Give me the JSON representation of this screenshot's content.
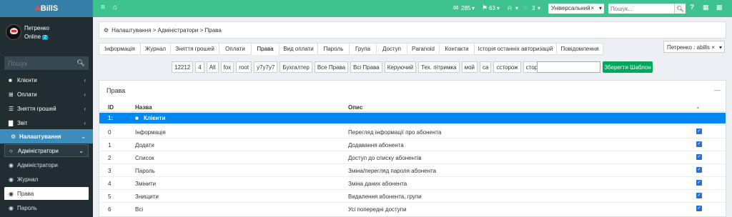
{
  "sidebar": {
    "logo_first": "A",
    "logo_rest": "BillS",
    "user_name": "Петренко",
    "user_status": "Online",
    "user_badge": "2",
    "search_placeholder": "Пошук",
    "menu": [
      {
        "label": "Клієнти",
        "icon": "user-icon"
      },
      {
        "label": "Оплати",
        "icon": "plus-square-icon"
      },
      {
        "label": "Зняття грошей",
        "icon": "list-icon"
      },
      {
        "label": "Звіт",
        "icon": "bar-chart-icon"
      },
      {
        "label": "Налаштування",
        "icon": "gear-icon"
      }
    ],
    "submenu_open": "Адміністратори",
    "submenu": [
      "Адміністратори",
      "Журнал",
      "Права",
      "Пароль"
    ]
  },
  "topbar": {
    "mail_count": "285",
    "flag_count": "63",
    "chat_count": "3",
    "mode_select": "Універсальний",
    "search_placeholder": "Пошук..."
  },
  "breadcrumb": "Налаштування > Адміністратори > Права",
  "tabs": [
    "Інформація",
    "Журнал",
    "Зняття грошей",
    "Оплати",
    "Права",
    "Вид оплати",
    "Пароль",
    "Група",
    "Доступ",
    "Paranoid",
    "Контакти",
    "Історія останніх авторизацій",
    "Повідомлення"
  ],
  "admin_select": "Петренко : abills",
  "chips": [
    "12212",
    "4",
    "All",
    "fox",
    "root",
    "y7y7y7",
    "Бухгалтер",
    "Все Права",
    "Всі Права",
    "Керуючий",
    "Тех. пітримка",
    "мой",
    "са",
    "cсторож",
    "сторож"
  ],
  "save_button": "Зберегти Шаблон",
  "panel": {
    "title": "Права",
    "collapse": "—",
    "headers": {
      "id": "ID",
      "name": "Назва",
      "desc": "Опис",
      "check": "-"
    },
    "group": {
      "id": "1:",
      "name": "Клієнти"
    },
    "rows": [
      {
        "id": "0",
        "name": "Інформація",
        "desc": "Перегляд інформації про абонента"
      },
      {
        "id": "1",
        "name": "Додати",
        "desc": "Додавання абонента"
      },
      {
        "id": "2",
        "name": "Список",
        "desc": "Доступ до списку абонентів"
      },
      {
        "id": "3",
        "name": "Пароль",
        "desc": "Зміна/перегляд пароля абонента"
      },
      {
        "id": "4",
        "name": "Змінити",
        "desc": "Зміна даних абонента"
      },
      {
        "id": "5",
        "name": "Знищити",
        "desc": "Видалення абонента, групи"
      },
      {
        "id": "6",
        "name": "Всі",
        "desc": "Усі попередні доступи"
      }
    ]
  }
}
